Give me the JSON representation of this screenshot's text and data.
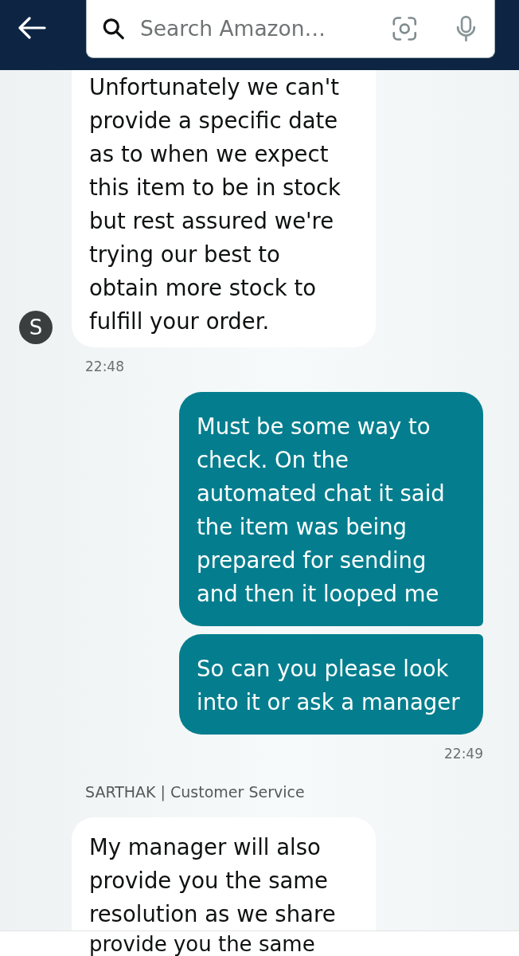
{
  "search": {
    "placeholder": "Search Amazon…"
  },
  "conversation": [
    {
      "kind": "agent",
      "avatar": "S",
      "messages": [
        "Unfortunately we can't provide a specific date as to when we expect this item to be in stock but rest assured we're trying our best to obtain more stock to fulfill your order."
      ],
      "time": "22:48"
    },
    {
      "kind": "customer",
      "messages": [
        "Must be some way to check. On the automated chat it said the item was being prepared for sending and then it looped me",
        "So can you please look into it or ask a manager"
      ],
      "time": "22:49"
    },
    {
      "kind": "agent",
      "sender": "SARTHAK | Customer Service",
      "messages": [
        "My manager will also provide you the same resolution as we share"
      ]
    }
  ],
  "bottom_strip": {
    "text": "provide you the same"
  }
}
